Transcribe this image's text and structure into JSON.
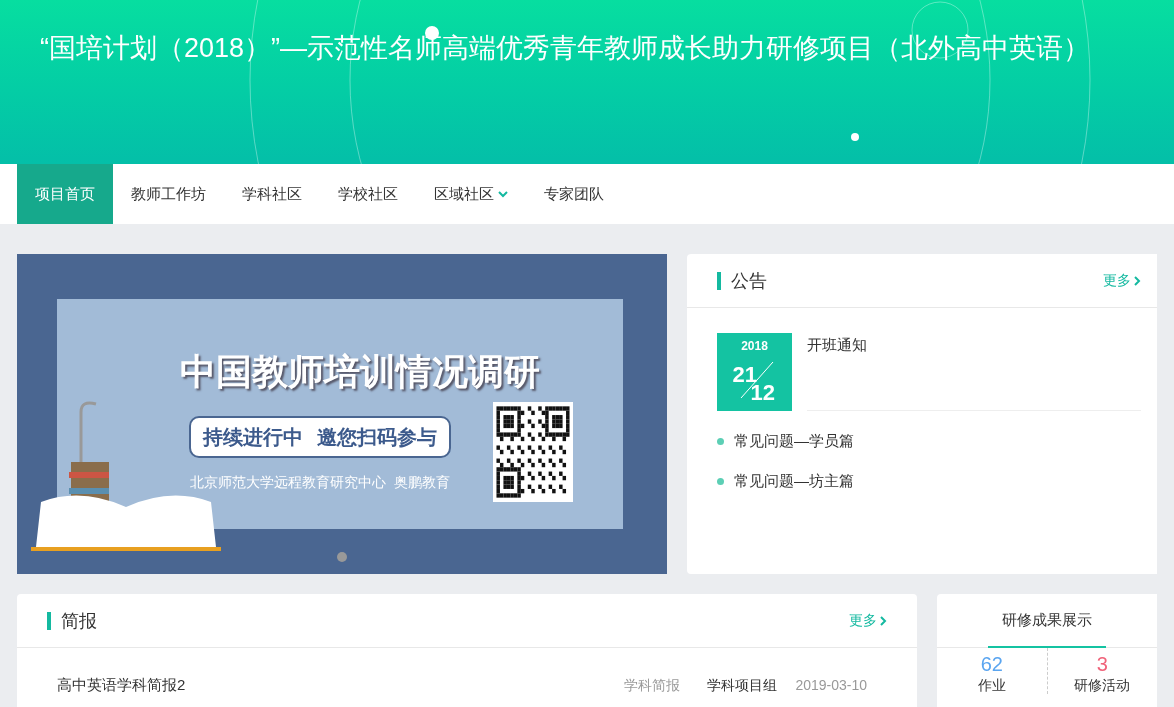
{
  "header": {
    "title": "“国培计划（2018）”—示范性名师高端优秀青年教师成长助力研修项目（北外高中英语）"
  },
  "nav": [
    {
      "label": "项目首页",
      "selected": true,
      "dropdown": false
    },
    {
      "label": "教师工作坊",
      "selected": false,
      "dropdown": false
    },
    {
      "label": "学科社区",
      "selected": false,
      "dropdown": false
    },
    {
      "label": "学校社区",
      "selected": false,
      "dropdown": false
    },
    {
      "label": "区域社区",
      "selected": false,
      "dropdown": true
    },
    {
      "label": "专家团队",
      "selected": false,
      "dropdown": false
    }
  ],
  "banner": {
    "title": "中国教师培训情况调研",
    "pill": "持续进行中  邀您扫码参与",
    "credit": "北京师范大学远程教育研究中心  奥鹏教育"
  },
  "notice": {
    "title": "公告",
    "more": "更多",
    "featured": {
      "year": "2018",
      "day": "21",
      "month": "12",
      "title": "开班通知"
    },
    "items": [
      "常见问题—学员篇",
      "常见问题—坊主篇"
    ]
  },
  "briefing": {
    "title": "简报",
    "more": "更多",
    "rows": [
      {
        "title": "高中英语学科简报2",
        "category": "学科简报",
        "author": "学科项目组",
        "date": "2019-03-10"
      }
    ]
  },
  "results": {
    "title": "研修成果展示",
    "stats": [
      {
        "value": "62",
        "label": "作业",
        "color": "#5aa5f0"
      },
      {
        "value": "3",
        "label": "研修活动",
        "color": "#f0637a"
      }
    ]
  }
}
